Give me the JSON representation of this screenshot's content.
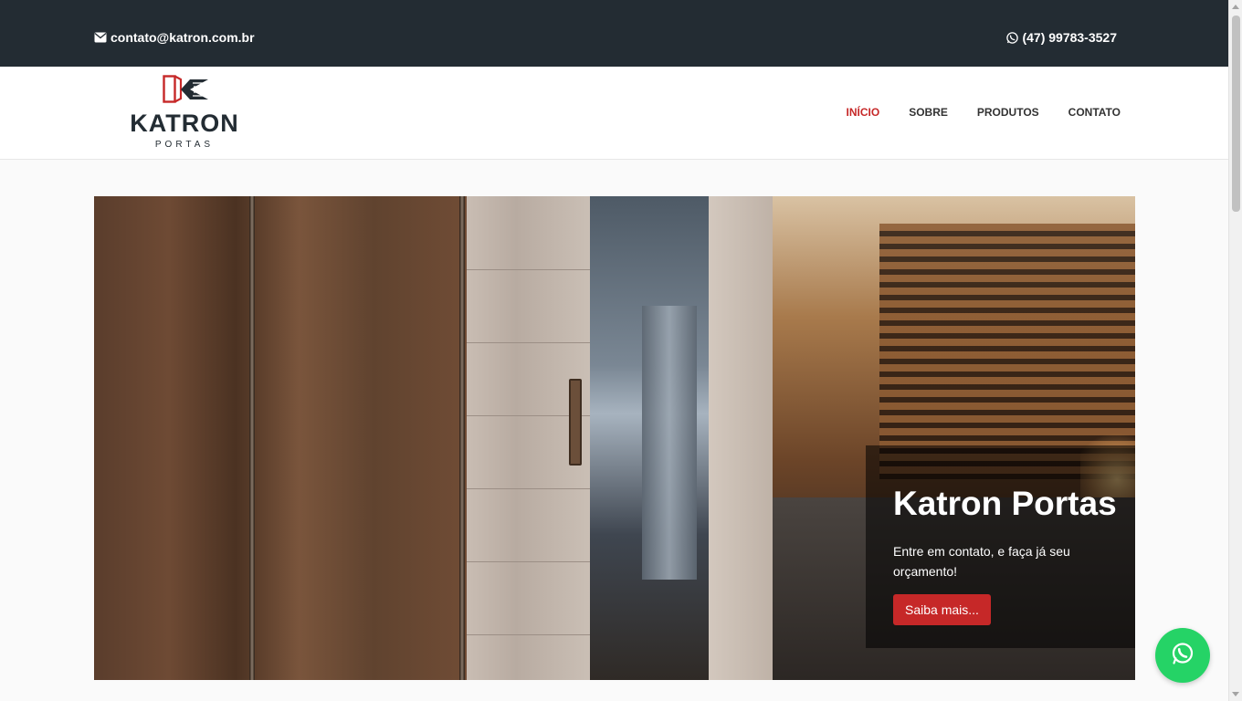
{
  "topbar": {
    "email": "contato@katron.com.br",
    "email_icon": "envelope-icon",
    "phone": "(47) 99783-3527",
    "phone_icon": "whatsapp-icon"
  },
  "logo": {
    "brand": "KATRON",
    "sub": "PORTAS"
  },
  "nav": {
    "items": [
      {
        "label": "INÍCIO",
        "active": true
      },
      {
        "label": "SOBRE",
        "active": false
      },
      {
        "label": "PRODUTOS",
        "active": false
      },
      {
        "label": "CONTATO",
        "active": false
      }
    ]
  },
  "hero": {
    "title": "Katron Portas",
    "text": "Entre em contato, e faça já seu orçamento!",
    "button_label": "Saiba mais..."
  },
  "floating": {
    "icon": "whatsapp-icon"
  },
  "colors": {
    "topbar_bg": "#232c33",
    "accent": "#c62828",
    "whatsapp": "#25d366"
  }
}
